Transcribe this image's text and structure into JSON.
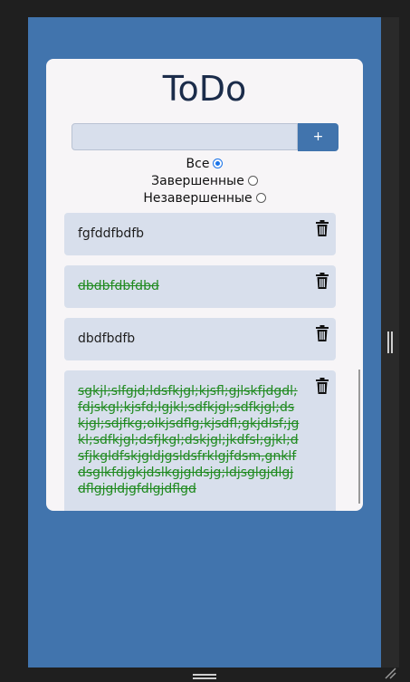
{
  "app": {
    "title": "ToDo"
  },
  "input": {
    "value": "",
    "placeholder": ""
  },
  "add_button": {
    "label": "+"
  },
  "filters": [
    {
      "label": "Все",
      "checked": true
    },
    {
      "label": "Завершенные",
      "checked": false
    },
    {
      "label": "Незавершенные",
      "checked": false
    }
  ],
  "todos": [
    {
      "text": "fgfddfbdfb",
      "done": false
    },
    {
      "text": "dbdbfdbfdbd",
      "done": true
    },
    {
      "text": "dbdfbdfb",
      "done": false
    },
    {
      "text": "sgkjl;slfgjd;ldsfkjgl;kjsfl;gjlskfjdgdl;fdjskgl;kjsfd;lgjkl;sdfkjgl;sdfkjgl;dskjgl;sdjfkg;olkjsdflg;kjsdfl;gkjdlsf;jgkl;sdfkjgl;dsfjkgl;dskjgl;jkdfsl;gjkl;dsfjkgldfskjgldjgsldsfrklgjfdsm,gnklfdsglkfdjgkjdslkgjgldsjg;ldjsglgjdlgjdflgjgldjgfdlgjdflgd",
      "done": true
    }
  ],
  "icons": {
    "delete": "trash-icon"
  },
  "colors": {
    "background": "#4174ad",
    "accent": "#4174ad",
    "item_bg": "#d8dfec",
    "done_text": "#1f8a1f"
  }
}
